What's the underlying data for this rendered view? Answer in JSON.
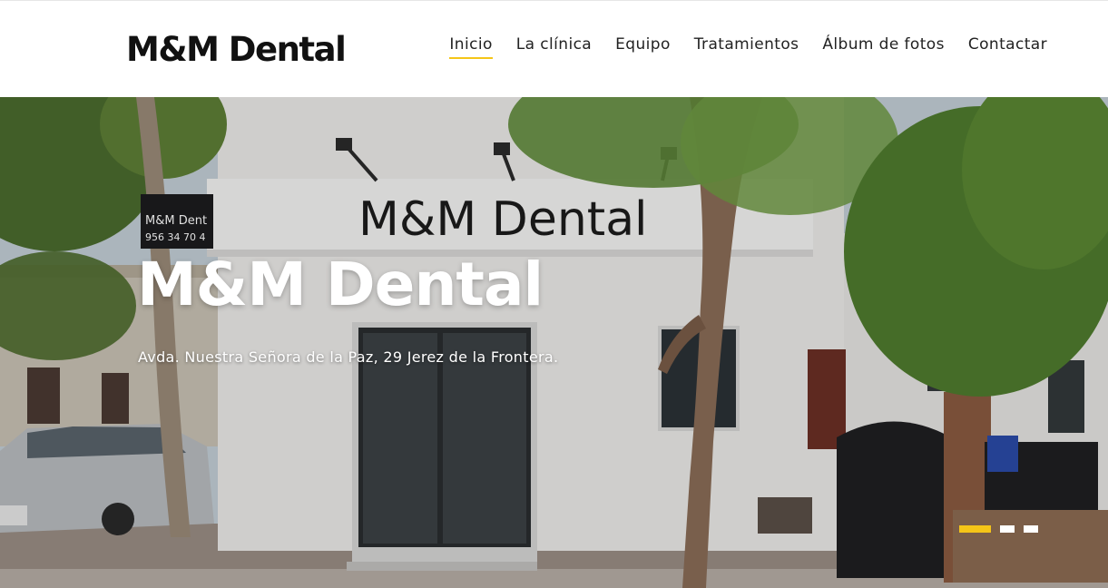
{
  "brand": {
    "logo_text": "M&M Dental",
    "accent_color": "#f5c518"
  },
  "nav": {
    "items": [
      {
        "label": "Inicio",
        "active": true
      },
      {
        "label": "La clínica",
        "active": false
      },
      {
        "label": "Equipo",
        "active": false
      },
      {
        "label": "Tratamientos",
        "active": false
      },
      {
        "label": "Álbum de fotos",
        "active": false
      },
      {
        "label": "Contactar",
        "active": false
      }
    ]
  },
  "hero": {
    "title": "M&M Dental",
    "address": "Avda. Nuestra Señora de la Paz, 29 Jerez de la Frontera.",
    "building_sign": "M&M Dental",
    "side_sign_name": "M&M Dent",
    "side_sign_phone": "956 34 70 4"
  },
  "slider": {
    "slide_count": 3,
    "active_slide": 1
  }
}
